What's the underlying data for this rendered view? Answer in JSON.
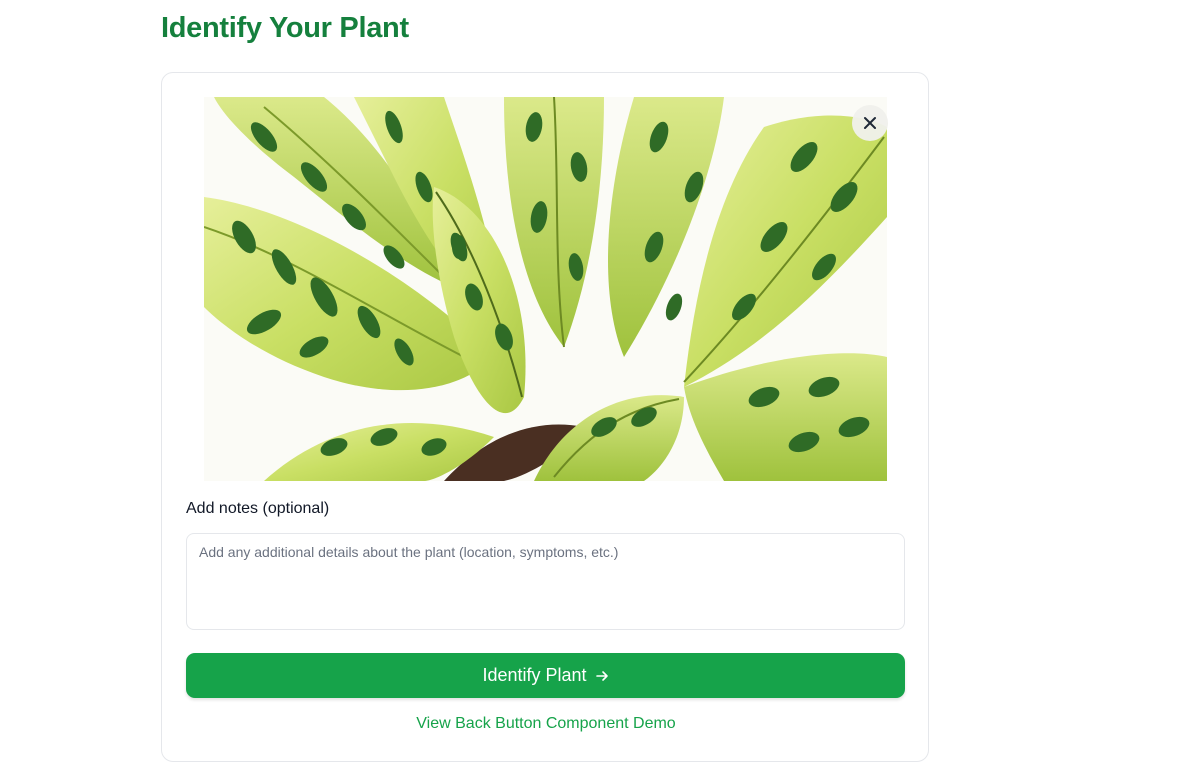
{
  "page": {
    "title": "Identify Your Plant"
  },
  "upload": {
    "remove_icon": "close-icon",
    "photo_subject": "calathea-lancifolia-leaves"
  },
  "notes": {
    "label": "Add notes (optional)",
    "placeholder": "Add any additional details about the plant (location, symptoms, etc.)",
    "value": ""
  },
  "actions": {
    "identify_label": "Identify Plant",
    "identify_icon": "arrow-right-icon",
    "demo_link": "View Back Button Component Demo"
  },
  "colors": {
    "brand_green": "#16a34a",
    "title_green": "#15803d"
  }
}
